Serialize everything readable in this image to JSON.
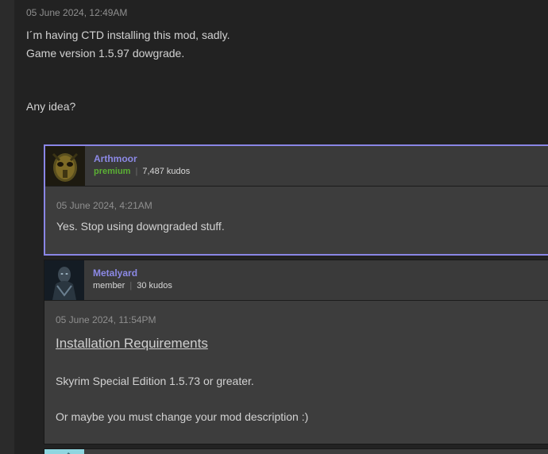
{
  "post": {
    "timestamp": "05 June 2024, 12:49AM",
    "lines": [
      "I´m having CTD installing this mod, sadly.",
      "Game version 1.5.97 dowgrade.",
      "Any idea?"
    ]
  },
  "replies": [
    {
      "author": "Arthmoor",
      "rank": "premium",
      "kudos": "7,487 kudos",
      "timestamp": "05 June 2024, 4:21AM",
      "text": "Yes. Stop using downgraded stuff."
    },
    {
      "author": "Metalyard",
      "rank": "member",
      "kudos": "30 kudos",
      "timestamp": "05 June 2024, 11:54PM",
      "link": "Installation Requirements",
      "text1": "Skyrim Special Edition 1.5.73 or greater.",
      "text2": "Or maybe you must change your mod description :)"
    }
  ],
  "colors": {
    "highlight_border": "#8a86e6",
    "author_name": "#8c89e6",
    "premium": "#5bb034"
  }
}
